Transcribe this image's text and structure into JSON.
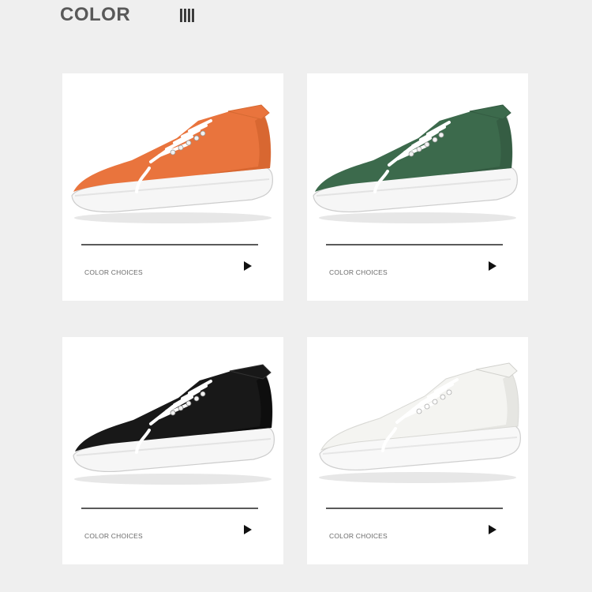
{
  "header": {
    "title": "COLOR",
    "decoration_icon": "four-vertical-bars-icon"
  },
  "cards": [
    {
      "caption": "COLOR CHOICES",
      "shoe_color": "#e9743d",
      "shoe_shade": "#c75a26",
      "arrow_icon": "play-triangle-icon"
    },
    {
      "caption": "COLOR CHOICES",
      "shoe_color": "#3c6a4c",
      "shoe_shade": "#2d5039",
      "arrow_icon": "play-triangle-icon"
    },
    {
      "caption": "COLOR CHOICES",
      "shoe_color": "#181818",
      "shoe_shade": "#0a0a0a",
      "arrow_icon": "play-triangle-icon"
    },
    {
      "caption": "COLOR CHOICES",
      "shoe_color": "#f4f4f1",
      "shoe_shade": "#dcdcd8",
      "arrow_icon": "play-triangle-icon"
    }
  ],
  "colors": {
    "background": "#efefef",
    "card": "#ffffff",
    "rule": "#5a5a5a",
    "text": "#595959"
  }
}
